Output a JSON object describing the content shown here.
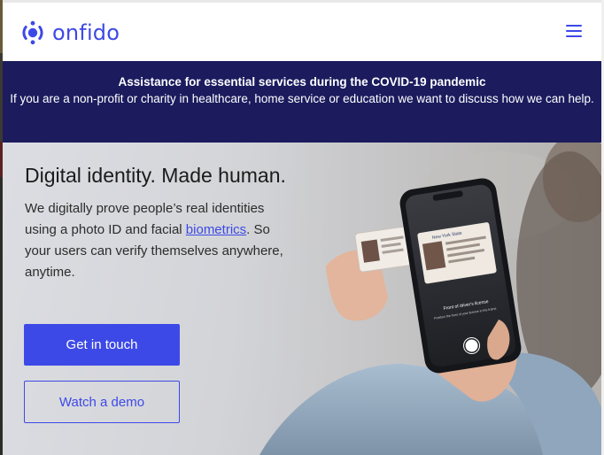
{
  "brand": {
    "name": "onfido",
    "accent_color": "#3d49e6",
    "logo_icon": "onfido-logo-icon"
  },
  "header": {
    "menu_icon": "hamburger-menu-icon"
  },
  "banner": {
    "title": "Assistance for essential services during the COVID-19 pandemic",
    "body": "If you are a non-profit or charity in healthcare, home service or education we want to discuss how we can help.",
    "background_color": "#1b1b5e"
  },
  "hero": {
    "title": "Digital identity. Made human.",
    "subtitle_before_link": "We digitally prove people’s real identities using a photo ID and facial ",
    "subtitle_link": "biometrics",
    "subtitle_after_link": ". So your users can verify themselves anywhere, anytime.",
    "primary_button": "Get in touch",
    "secondary_button": "Watch a demo",
    "phone_screen": {
      "id_heading": "New York State",
      "caption_title": "Front of driver's license",
      "caption_sub": "Position the front of your license in the frame"
    }
  }
}
